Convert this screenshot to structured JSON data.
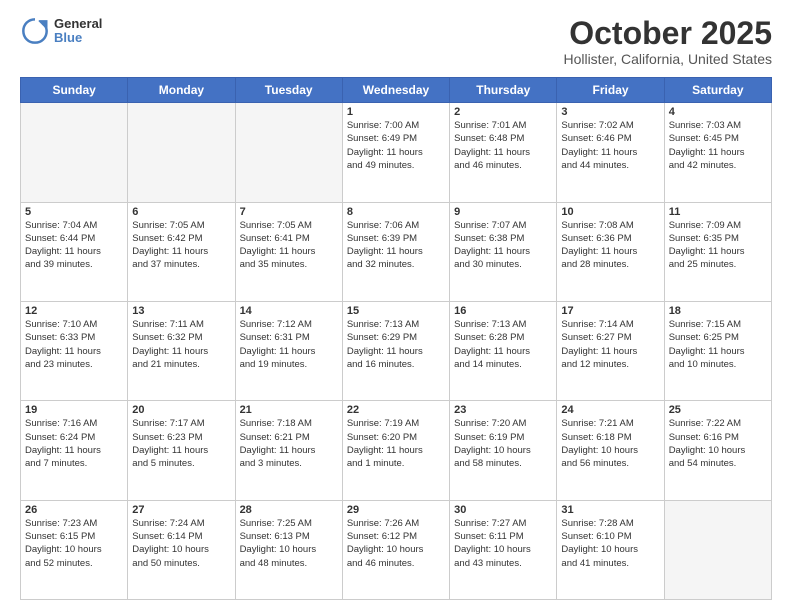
{
  "logo": {
    "general": "General",
    "blue": "Blue"
  },
  "title": {
    "month": "October 2025",
    "location": "Hollister, California, United States"
  },
  "days_of_week": [
    "Sunday",
    "Monday",
    "Tuesday",
    "Wednesday",
    "Thursday",
    "Friday",
    "Saturday"
  ],
  "weeks": [
    [
      {
        "day": "",
        "info": "",
        "empty": true
      },
      {
        "day": "",
        "info": "",
        "empty": true
      },
      {
        "day": "",
        "info": "",
        "empty": true
      },
      {
        "day": "1",
        "info": "Sunrise: 7:00 AM\nSunset: 6:49 PM\nDaylight: 11 hours\nand 49 minutes.",
        "empty": false
      },
      {
        "day": "2",
        "info": "Sunrise: 7:01 AM\nSunset: 6:48 PM\nDaylight: 11 hours\nand 46 minutes.",
        "empty": false
      },
      {
        "day": "3",
        "info": "Sunrise: 7:02 AM\nSunset: 6:46 PM\nDaylight: 11 hours\nand 44 minutes.",
        "empty": false
      },
      {
        "day": "4",
        "info": "Sunrise: 7:03 AM\nSunset: 6:45 PM\nDaylight: 11 hours\nand 42 minutes.",
        "empty": false
      }
    ],
    [
      {
        "day": "5",
        "info": "Sunrise: 7:04 AM\nSunset: 6:44 PM\nDaylight: 11 hours\nand 39 minutes.",
        "empty": false
      },
      {
        "day": "6",
        "info": "Sunrise: 7:05 AM\nSunset: 6:42 PM\nDaylight: 11 hours\nand 37 minutes.",
        "empty": false
      },
      {
        "day": "7",
        "info": "Sunrise: 7:05 AM\nSunset: 6:41 PM\nDaylight: 11 hours\nand 35 minutes.",
        "empty": false
      },
      {
        "day": "8",
        "info": "Sunrise: 7:06 AM\nSunset: 6:39 PM\nDaylight: 11 hours\nand 32 minutes.",
        "empty": false
      },
      {
        "day": "9",
        "info": "Sunrise: 7:07 AM\nSunset: 6:38 PM\nDaylight: 11 hours\nand 30 minutes.",
        "empty": false
      },
      {
        "day": "10",
        "info": "Sunrise: 7:08 AM\nSunset: 6:36 PM\nDaylight: 11 hours\nand 28 minutes.",
        "empty": false
      },
      {
        "day": "11",
        "info": "Sunrise: 7:09 AM\nSunset: 6:35 PM\nDaylight: 11 hours\nand 25 minutes.",
        "empty": false
      }
    ],
    [
      {
        "day": "12",
        "info": "Sunrise: 7:10 AM\nSunset: 6:33 PM\nDaylight: 11 hours\nand 23 minutes.",
        "empty": false
      },
      {
        "day": "13",
        "info": "Sunrise: 7:11 AM\nSunset: 6:32 PM\nDaylight: 11 hours\nand 21 minutes.",
        "empty": false
      },
      {
        "day": "14",
        "info": "Sunrise: 7:12 AM\nSunset: 6:31 PM\nDaylight: 11 hours\nand 19 minutes.",
        "empty": false
      },
      {
        "day": "15",
        "info": "Sunrise: 7:13 AM\nSunset: 6:29 PM\nDaylight: 11 hours\nand 16 minutes.",
        "empty": false
      },
      {
        "day": "16",
        "info": "Sunrise: 7:13 AM\nSunset: 6:28 PM\nDaylight: 11 hours\nand 14 minutes.",
        "empty": false
      },
      {
        "day": "17",
        "info": "Sunrise: 7:14 AM\nSunset: 6:27 PM\nDaylight: 11 hours\nand 12 minutes.",
        "empty": false
      },
      {
        "day": "18",
        "info": "Sunrise: 7:15 AM\nSunset: 6:25 PM\nDaylight: 11 hours\nand 10 minutes.",
        "empty": false
      }
    ],
    [
      {
        "day": "19",
        "info": "Sunrise: 7:16 AM\nSunset: 6:24 PM\nDaylight: 11 hours\nand 7 minutes.",
        "empty": false
      },
      {
        "day": "20",
        "info": "Sunrise: 7:17 AM\nSunset: 6:23 PM\nDaylight: 11 hours\nand 5 minutes.",
        "empty": false
      },
      {
        "day": "21",
        "info": "Sunrise: 7:18 AM\nSunset: 6:21 PM\nDaylight: 11 hours\nand 3 minutes.",
        "empty": false
      },
      {
        "day": "22",
        "info": "Sunrise: 7:19 AM\nSunset: 6:20 PM\nDaylight: 11 hours\nand 1 minute.",
        "empty": false
      },
      {
        "day": "23",
        "info": "Sunrise: 7:20 AM\nSunset: 6:19 PM\nDaylight: 10 hours\nand 58 minutes.",
        "empty": false
      },
      {
        "day": "24",
        "info": "Sunrise: 7:21 AM\nSunset: 6:18 PM\nDaylight: 10 hours\nand 56 minutes.",
        "empty": false
      },
      {
        "day": "25",
        "info": "Sunrise: 7:22 AM\nSunset: 6:16 PM\nDaylight: 10 hours\nand 54 minutes.",
        "empty": false
      }
    ],
    [
      {
        "day": "26",
        "info": "Sunrise: 7:23 AM\nSunset: 6:15 PM\nDaylight: 10 hours\nand 52 minutes.",
        "empty": false
      },
      {
        "day": "27",
        "info": "Sunrise: 7:24 AM\nSunset: 6:14 PM\nDaylight: 10 hours\nand 50 minutes.",
        "empty": false
      },
      {
        "day": "28",
        "info": "Sunrise: 7:25 AM\nSunset: 6:13 PM\nDaylight: 10 hours\nand 48 minutes.",
        "empty": false
      },
      {
        "day": "29",
        "info": "Sunrise: 7:26 AM\nSunset: 6:12 PM\nDaylight: 10 hours\nand 46 minutes.",
        "empty": false
      },
      {
        "day": "30",
        "info": "Sunrise: 7:27 AM\nSunset: 6:11 PM\nDaylight: 10 hours\nand 43 minutes.",
        "empty": false
      },
      {
        "day": "31",
        "info": "Sunrise: 7:28 AM\nSunset: 6:10 PM\nDaylight: 10 hours\nand 41 minutes.",
        "empty": false
      },
      {
        "day": "",
        "info": "",
        "empty": true
      }
    ]
  ]
}
